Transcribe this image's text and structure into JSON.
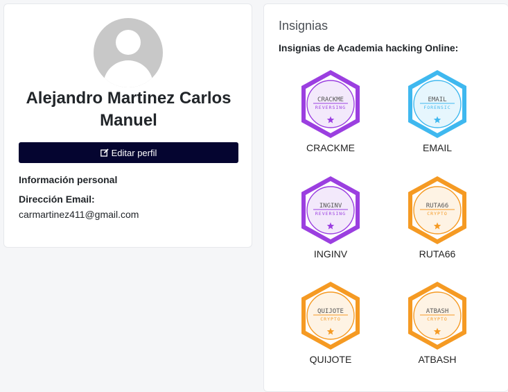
{
  "profile": {
    "name": "Alejandro Martinez Carlos Manuel",
    "edit_button_label": "Editar perfil",
    "personal_info_title": "Información personal",
    "email_label": "Dirección Email:",
    "email_value": "carmartinez411@gmail.com"
  },
  "badges": {
    "title": "Insignias",
    "subtitle": "Insignias de Academia hacking Online:",
    "items": [
      {
        "label": "CRACKME",
        "logo_text": "CRACKME",
        "category": "REVERSING",
        "color": "#9b3fe0",
        "fill": "#f3e9fb"
      },
      {
        "label": "EMAIL",
        "logo_text": "EMAIL",
        "category": "FORENSIC",
        "color": "#3fb8ef",
        "fill": "#e6f6fd"
      },
      {
        "label": "INGINV",
        "logo_text": "INGINV",
        "category": "REVERSING",
        "color": "#9b3fe0",
        "fill": "#f3e9fb"
      },
      {
        "label": "RUTA66",
        "logo_text": "RUTA66",
        "category": "CRYPTO",
        "color": "#f59a23",
        "fill": "#fef3e4"
      },
      {
        "label": "QUIJOTE",
        "logo_text": "QUIJOTE",
        "category": "CRYPTO",
        "color": "#f59a23",
        "fill": "#fef3e4"
      },
      {
        "label": "ATBASH",
        "logo_text": "ATBASH",
        "category": "CRYPTO",
        "color": "#f59a23",
        "fill": "#fef3e4"
      }
    ]
  },
  "icons": {
    "avatar": "default-user-avatar",
    "edit": "edit-icon",
    "badge_star": "star-icon"
  }
}
